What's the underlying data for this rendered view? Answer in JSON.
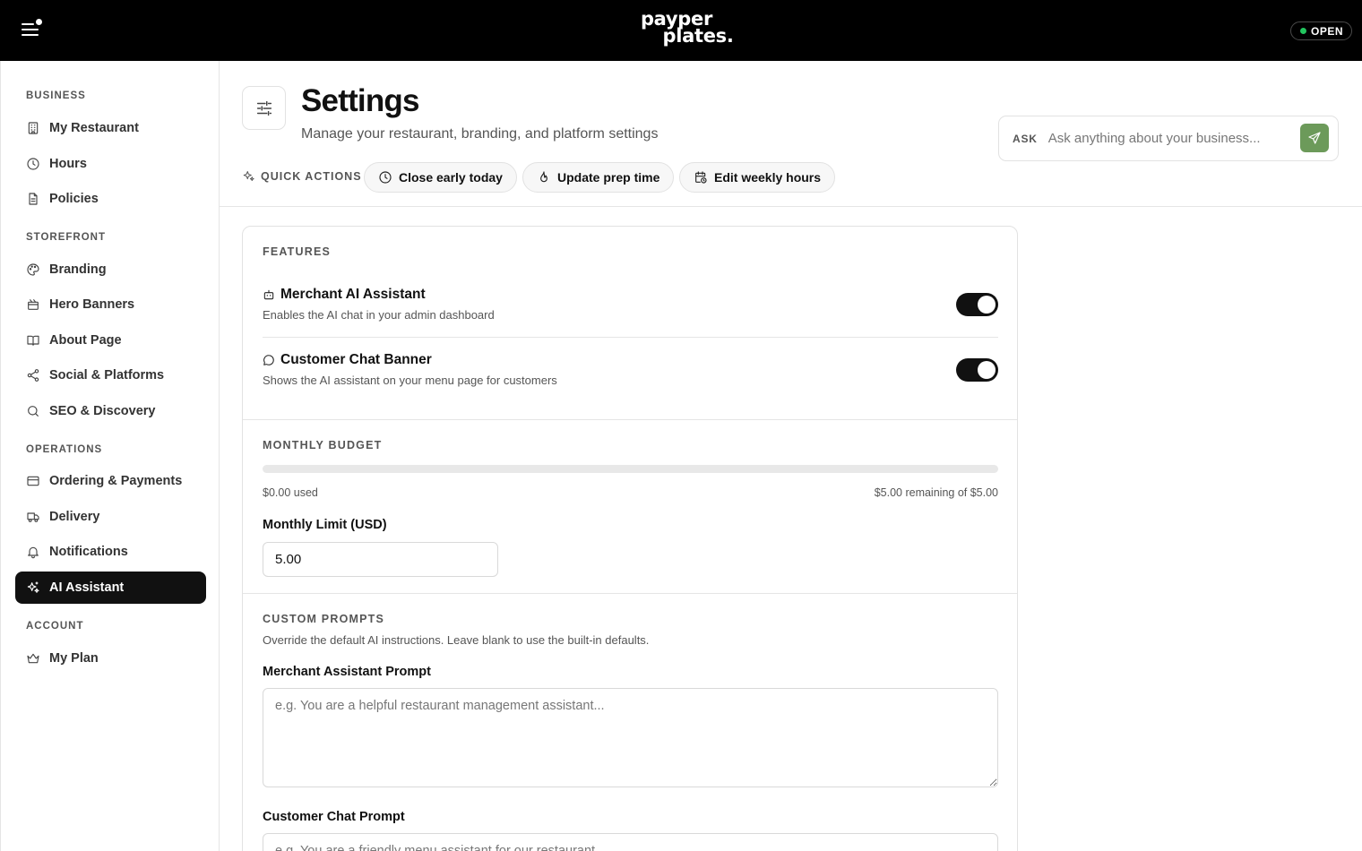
{
  "topbar": {
    "logo_line1": "payper",
    "logo_line2": "plates.",
    "status": "OPEN",
    "status_color": "#22c55e"
  },
  "sidebar": {
    "sections": [
      {
        "label": "BUSINESS",
        "items": [
          {
            "label": "My Restaurant",
            "icon": "building-icon"
          },
          {
            "label": "Hours",
            "icon": "clock-icon"
          },
          {
            "label": "Policies",
            "icon": "document-icon"
          }
        ]
      },
      {
        "label": "STOREFRONT",
        "items": [
          {
            "label": "Branding",
            "icon": "palette-icon"
          },
          {
            "label": "Hero Banners",
            "icon": "banner-icon"
          },
          {
            "label": "About Page",
            "icon": "book-icon"
          },
          {
            "label": "Social & Platforms",
            "icon": "share-icon"
          },
          {
            "label": "SEO & Discovery",
            "icon": "search-icon"
          }
        ]
      },
      {
        "label": "OPERATIONS",
        "items": [
          {
            "label": "Ordering & Payments",
            "icon": "credit-card-icon"
          },
          {
            "label": "Delivery",
            "icon": "truck-icon"
          },
          {
            "label": "Notifications",
            "icon": "bell-icon"
          },
          {
            "label": "AI Assistant",
            "icon": "sparkles-icon",
            "active": true
          }
        ]
      },
      {
        "label": "ACCOUNT",
        "items": [
          {
            "label": "My Plan",
            "icon": "crown-icon"
          }
        ]
      }
    ]
  },
  "header": {
    "title": "Settings",
    "subtitle": "Manage your restaurant, branding, and platform settings",
    "icon": "sliders-icon"
  },
  "quick_actions": {
    "label": "QUICK ACTIONS",
    "items": [
      {
        "label": "Close early today",
        "icon": "clock-icon"
      },
      {
        "label": "Update prep time",
        "icon": "flame-icon"
      },
      {
        "label": "Edit weekly hours",
        "icon": "calendar-clock-icon"
      }
    ]
  },
  "ask": {
    "label": "ASK",
    "placeholder": "Ask anything about your business...",
    "send_color": "#6c9a5a"
  },
  "features": {
    "title": "FEATURES",
    "items": [
      {
        "title": "Merchant AI Assistant",
        "description": "Enables the AI chat in your admin dashboard",
        "icon": "bot-icon",
        "enabled": true
      },
      {
        "title": "Customer Chat Banner",
        "description": "Shows the AI assistant on your menu page for customers",
        "icon": "chat-bubble-icon",
        "enabled": true
      }
    ]
  },
  "budget": {
    "title": "MONTHLY BUDGET",
    "used_fraction": 0,
    "used_text": "$0.00 used",
    "remaining_text": "$5.00 remaining of $5.00",
    "limit_label": "Monthly Limit (USD)",
    "limit_value": "5.00"
  },
  "prompts": {
    "title": "CUSTOM PROMPTS",
    "description": "Override the default AI instructions. Leave blank to use the built-in defaults.",
    "merchant_label": "Merchant Assistant Prompt",
    "merchant_placeholder": "e.g. You are a helpful restaurant management assistant...",
    "customer_label": "Customer Chat Prompt",
    "customer_placeholder": "e.g. You are a friendly menu assistant for our restaurant..."
  }
}
